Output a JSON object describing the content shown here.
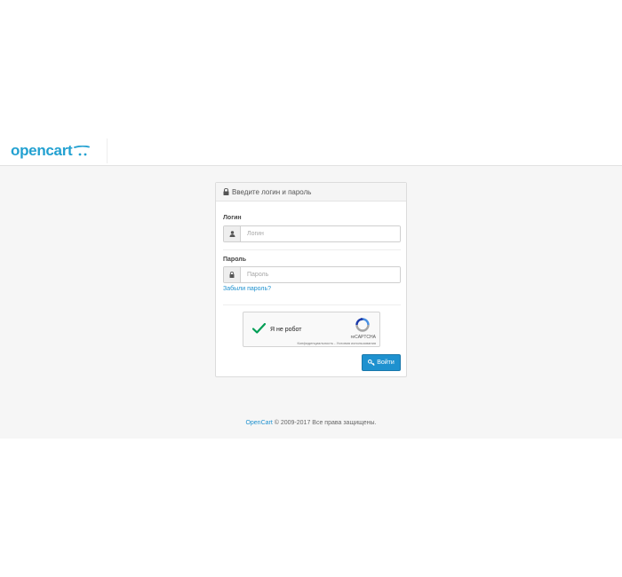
{
  "header": {
    "logo_text": "opencart"
  },
  "login_panel": {
    "heading": "Введите логин и пароль",
    "username": {
      "label": "Логин",
      "placeholder": "Логин"
    },
    "password": {
      "label": "Пароль",
      "placeholder": "Пароль"
    },
    "forgot_link": "Забыли пароль?",
    "captcha": {
      "label": "Я не робот",
      "brand": "reCAPTCHA",
      "links": "Конфиденциальность - Условия использования"
    },
    "submit_label": "Войти"
  },
  "footer": {
    "link": "OpenCart",
    "text": " © 2009-2017 Все права защищены."
  },
  "colors": {
    "brand": "#23a1d1",
    "primary_button": "#1e91cf",
    "background": "#f6f6f6",
    "captcha_check": "#009e55"
  }
}
